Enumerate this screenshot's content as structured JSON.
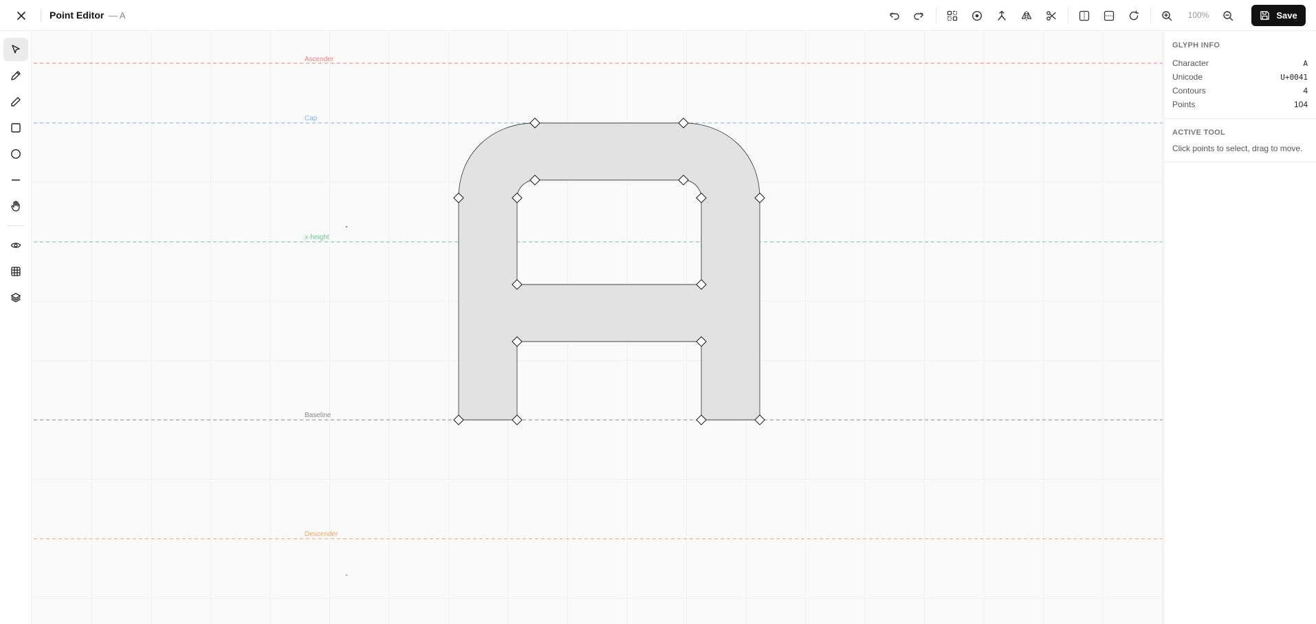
{
  "header": {
    "title": "Point Editor",
    "subtitle": "— A",
    "zoom": "100%",
    "save_label": "Save"
  },
  "toolbar_icons": [
    "undo-icon",
    "redo-icon",
    "select-points-icon",
    "target-icon",
    "merge-icon",
    "mirror-icon",
    "scissors-icon",
    "flip-horizontal-icon",
    "flip-vertical-icon",
    "rotate-icon",
    "zoom-in-icon",
    "zoom-out-icon",
    "save-icon"
  ],
  "left_tools": [
    "pointer-icon",
    "pen-icon",
    "pencil-icon",
    "rectangle-icon",
    "circle-icon",
    "line-icon",
    "hand-icon",
    "eye-icon",
    "grid-icon",
    "layers-icon"
  ],
  "guides": {
    "ascender": {
      "label": "Ascender",
      "color": "#f07c7c"
    },
    "cap": {
      "label": "Cap",
      "color": "#7fb2e8"
    },
    "xheight": {
      "label": "x-height",
      "color": "#6cc99a"
    },
    "baseline": {
      "label": "Baseline",
      "color": "#888888"
    },
    "descender": {
      "label": "Descender",
      "color": "#f0a45f"
    }
  },
  "panel": {
    "glyph_info_title": "GLYPH INFO",
    "rows": [
      {
        "label": "Character",
        "value": "A"
      },
      {
        "label": "Unicode",
        "value": "U+0041"
      },
      {
        "label": "Contours",
        "value": "4"
      },
      {
        "label": "Points",
        "value": "104"
      }
    ],
    "active_tool_title": "ACTIVE TOOL",
    "active_tool_desc": "Click points to select, drag to move."
  },
  "colors": {
    "glyph_fill": "#e2e2e2",
    "save_bg": "#111111"
  }
}
